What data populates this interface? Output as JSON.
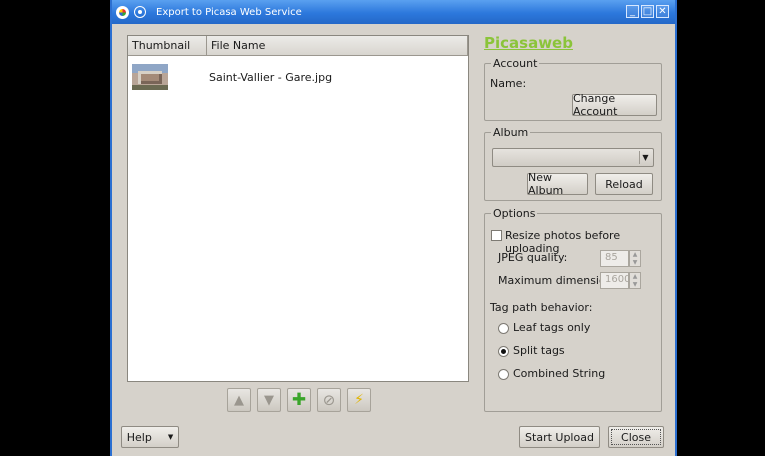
{
  "window": {
    "title": "Export to Picasa Web Service"
  },
  "wm": {
    "minimize": "_",
    "maximize": "□",
    "close": "✕"
  },
  "list": {
    "columns": [
      "Thumbnail",
      "File Name"
    ],
    "rows": [
      {
        "file": "Saint-Vallier - Gare.jpg"
      }
    ]
  },
  "toolbar": {
    "up": "▲",
    "down": "▼",
    "add": "✚",
    "remove": "⊘",
    "upload": "⚡"
  },
  "brand": "Picasaweb",
  "account": {
    "title": "Account",
    "name_label": "Name:",
    "change_button": "Change Account"
  },
  "album": {
    "title": "Album",
    "selected": "",
    "new_button": "New Album",
    "reload_button": "Reload"
  },
  "options": {
    "title": "Options",
    "resize_label": "Resize photos before uploading",
    "resize_checked": false,
    "jpeg_label": "JPEG quality:",
    "jpeg_value": "85",
    "maxdim_label": "Maximum dimension:",
    "maxdim_value": "1600",
    "tagpath_label": "Tag path behavior:",
    "tag_options": [
      "Leaf tags only",
      "Split tags",
      "Combined String"
    ],
    "tag_selected": "Split tags"
  },
  "footer": {
    "help": "Help",
    "start_upload": "Start Upload",
    "close": "Close"
  },
  "colors": {
    "accent": "#8bc43a",
    "titlebar": "#2c78dc"
  }
}
